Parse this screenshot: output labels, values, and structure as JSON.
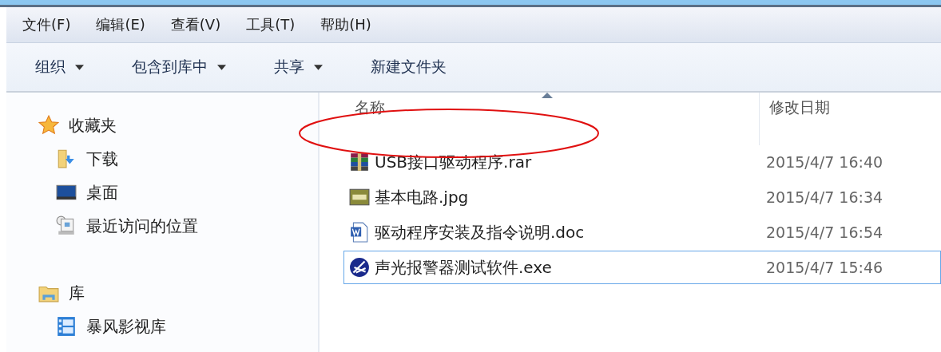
{
  "menu": [
    "文件(F)",
    "编辑(E)",
    "查看(V)",
    "工具(T)",
    "帮助(H)"
  ],
  "toolbar": [
    {
      "label": "组织",
      "dropdown": true
    },
    {
      "label": "包含到库中",
      "dropdown": true
    },
    {
      "label": "共享",
      "dropdown": true
    },
    {
      "label": "新建文件夹",
      "dropdown": false
    }
  ],
  "sidebar": [
    {
      "label": "收藏夹",
      "kind": "star",
      "children": [
        {
          "label": "下载",
          "kind": "download"
        },
        {
          "label": "桌面",
          "kind": "desktop"
        },
        {
          "label": "最近访问的位置",
          "kind": "recent"
        }
      ]
    },
    {
      "label": "库",
      "kind": "library",
      "children": [
        {
          "label": "暴风影视库",
          "kind": "video"
        }
      ]
    }
  ],
  "columns": [
    {
      "label": "名称",
      "sorted": true
    },
    {
      "label": "修改日期",
      "sorted": false
    }
  ],
  "files": [
    {
      "name": "USB接口驱动程序.rar",
      "date": "2015/4/7 16:40",
      "kind": "rar",
      "focused": false
    },
    {
      "name": "基本电路.jpg",
      "date": "2015/4/7 16:34",
      "kind": "jpg",
      "focused": false
    },
    {
      "name": "驱动程序安装及指令说明.doc",
      "date": "2015/4/7 16:54",
      "kind": "doc",
      "focused": false
    },
    {
      "name": "声光报警器测试软件.exe",
      "date": "2015/4/7 15:46",
      "kind": "exe",
      "focused": true
    }
  ]
}
